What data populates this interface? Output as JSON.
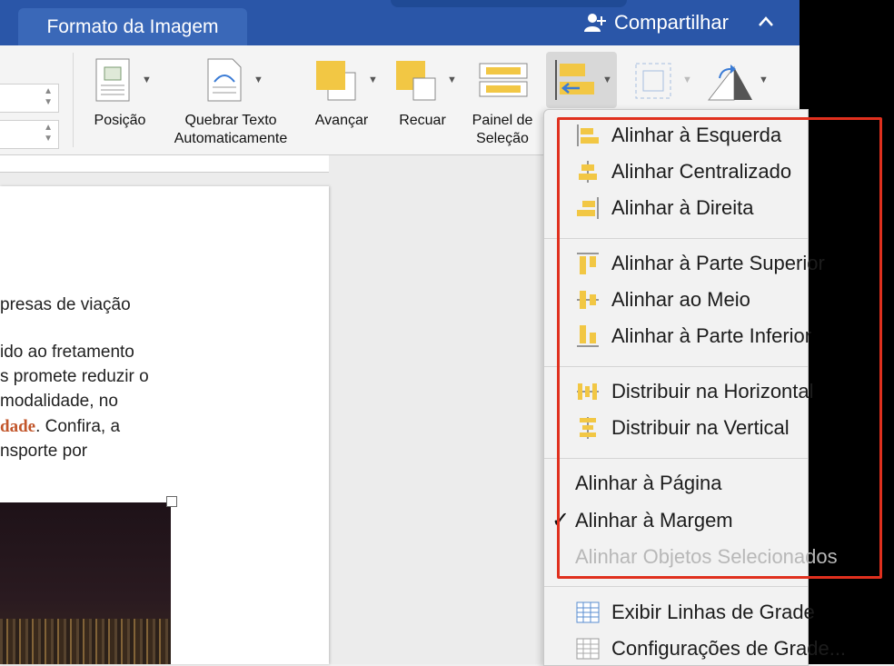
{
  "header": {
    "tab_label": "Formato da Imagem",
    "share_label": "Compartilhar",
    "share_icon": "add-person-icon",
    "collapse_icon": "chevron-up-icon"
  },
  "ribbon": {
    "position_label": "Posição",
    "wrap_label_1": "Quebrar Texto",
    "wrap_label_2": "Automaticamente",
    "forward_label": "Avançar",
    "backward_label": "Recuar",
    "selection_label_1": "Painel de",
    "selection_label_2": "Seleção"
  },
  "document": {
    "lines": [
      "presas de viação",
      "ido ao fretamento",
      "s promete reduzir o",
      " modalidade, no",
      "nsporte por"
    ],
    "mixed_line_highlight": "dade",
    "mixed_line_rest": ". Confira, a"
  },
  "menu": {
    "group1": [
      "Alinhar à Esquerda",
      "Alinhar Centralizado",
      "Alinhar à Direita"
    ],
    "group2": [
      "Alinhar à Parte Superior",
      "Alinhar ao Meio",
      "Alinhar à Parte Inferior"
    ],
    "group3": [
      "Distribuir na Horizontal",
      "Distribuir na Vertical"
    ],
    "group4": [
      "Alinhar à Página",
      "Alinhar à Margem",
      "Alinhar Objetos Selecionados"
    ],
    "checkmark": "✓",
    "group5": [
      "Exibir Linhas de Grade",
      "Configurações de Grade..."
    ]
  },
  "colors": {
    "title_bar": "#2a56a8",
    "icon_yellow": "#f2c744",
    "highlight_box": "#e0301e"
  }
}
